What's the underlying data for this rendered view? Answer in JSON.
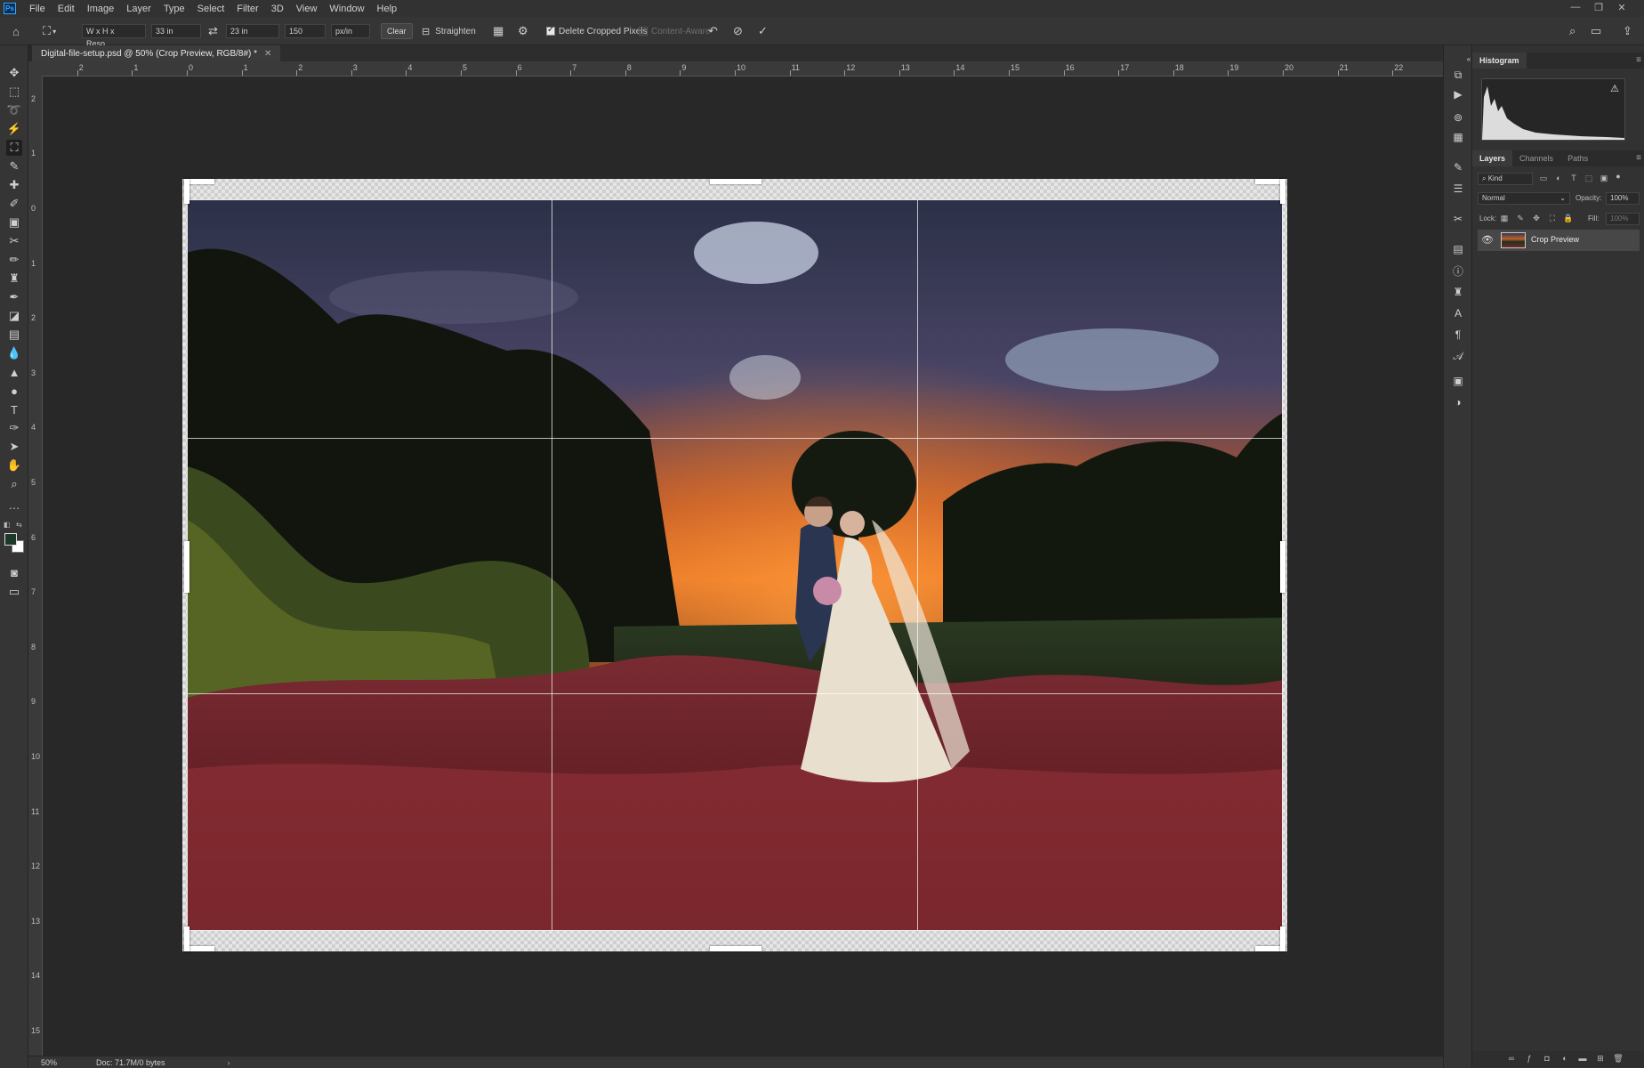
{
  "app": {
    "logo_text": "Ps"
  },
  "menu": [
    "File",
    "Edit",
    "Image",
    "Layer",
    "Type",
    "Select",
    "Filter",
    "3D",
    "View",
    "Window",
    "Help"
  ],
  "window_controls": {
    "minimize": "—",
    "restore": "❐",
    "close": "✕"
  },
  "options_bar": {
    "ratio_preset": "W x H x Reso...",
    "width_value": "33 in",
    "height_value": "23 in",
    "resolution_value": "150",
    "resolution_unit": "px/in",
    "clear_label": "Clear",
    "straighten_label": "Straighten",
    "delete_cropped_label": "Delete Cropped Pixels",
    "delete_cropped_checked": true,
    "content_aware_label": "Content-Aware",
    "content_aware_checked": false
  },
  "document": {
    "tab_title": "Digital-file-setup.psd @ 50% (Crop Preview, RGB/8#) *",
    "zoom": "50%",
    "doc_info": "Doc: 71.7M/0 bytes"
  },
  "ruler": {
    "top_labels": [
      "2",
      "1",
      "0",
      "1",
      "2",
      "3",
      "4",
      "5",
      "6",
      "7",
      "8",
      "9",
      "10",
      "11",
      "12",
      "13",
      "14",
      "15",
      "16",
      "17",
      "18",
      "19",
      "20",
      "21",
      "22"
    ],
    "left_labels": [
      "2",
      "1",
      "0",
      "1",
      "2",
      "3",
      "4",
      "5",
      "6",
      "7",
      "8",
      "9",
      "10",
      "11",
      "12",
      "13",
      "14",
      "15"
    ]
  },
  "panels": {
    "histogram_tab": "Histogram",
    "layers_tabs": [
      "Layers",
      "Channels",
      "Paths"
    ],
    "kind_placeholder": "Kind",
    "blend_mode": "Normal",
    "opacity_label": "Opacity:",
    "opacity_value": "100%",
    "lock_label": "Lock:",
    "fill_label": "Fill:",
    "fill_value": "100%",
    "layer_name": "Crop Preview"
  },
  "icons": {
    "tools": [
      "move-icon",
      "marquee-icon",
      "lasso-icon",
      "magic-wand-icon",
      "crop-icon",
      "eyedropper-icon",
      "healing-brush-icon",
      "patch-icon",
      "frame-icon",
      "brush-icon",
      "stamp-icon",
      "history-brush-icon",
      "eraser-icon",
      "gradient-icon",
      "blur-icon",
      "dodge-icon",
      "pen-icon",
      "type-icon",
      "path-select-icon",
      "shape-icon",
      "hand-icon",
      "zoom-icon",
      "more-tools-icon"
    ]
  },
  "colors": {
    "accent": "#31a8ff",
    "foreground_swatch": "#1c3828",
    "background_swatch": "#ffffff"
  }
}
